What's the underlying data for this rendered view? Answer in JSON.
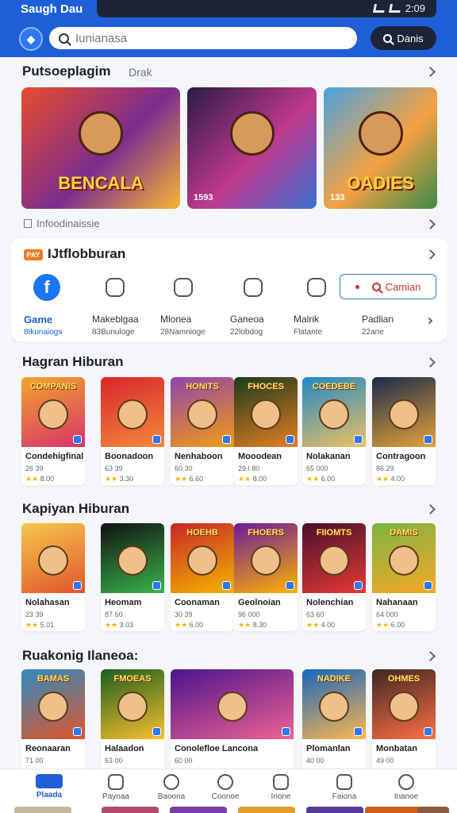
{
  "status": {
    "left": "Saugh Dau",
    "right": "2:09"
  },
  "search": {
    "placeholder": "Iunianasa",
    "button": "Danis"
  },
  "sections": {
    "featured": {
      "title": "Putsoeplagim",
      "subtitle": "Drak"
    },
    "note": "Infoodinaissie",
    "categories": {
      "badge": "PAY",
      "title": "IJtflobburan",
      "button": "Camian",
      "items": [
        {
          "label": "Game",
          "count": "8Ikunaiogs",
          "icon": "facebook-icon",
          "active": true
        },
        {
          "label": "Makeblgaa",
          "count": "83Bunuloge",
          "icon": "camera-icon"
        },
        {
          "label": "Mlonea",
          "count": "28Namnioge",
          "icon": "cross-icon"
        },
        {
          "label": "Ganeoa",
          "count": "22lobdog",
          "icon": "bag-icon"
        },
        {
          "label": "Malrik",
          "count": "Flatante",
          "icon": "receipt-icon"
        },
        {
          "label": "Padlian",
          "count": "22ane",
          "icon": "search-icon"
        }
      ]
    },
    "row1": {
      "title": "Hagran Hiburan"
    },
    "row2": {
      "title": "Kapiyan Hiburan"
    },
    "row3": {
      "title": "Ruakonig Ilaneoa:"
    }
  },
  "banners": [
    {
      "tag": "",
      "title": "BENCALA",
      "colors": [
        "#e94b2c",
        "#7b2d8e",
        "#f7b733"
      ]
    },
    {
      "tag": "1593",
      "title": "",
      "colors": [
        "#2a1a4a",
        "#c0398e",
        "#3a6fd1"
      ]
    },
    {
      "tag": "133",
      "title": "OADIES",
      "colors": [
        "#4aa3e0",
        "#f5a142",
        "#3a8a4a"
      ]
    }
  ],
  "games_row1": [
    {
      "name": "Condehigfinal",
      "size": "26 39",
      "rating": "8.00",
      "art": "COMPANIS",
      "colors": [
        "#f2a52b",
        "#d6336c"
      ]
    },
    {
      "name": "Boonadoon",
      "size": "63 39",
      "rating": "3.30",
      "art": "",
      "colors": [
        "#d7262b",
        "#f28a3a"
      ]
    },
    {
      "name": "Nenhaboon",
      "size": "60 30",
      "rating": "6.60",
      "art": "HONITS",
      "colors": [
        "#8e44ad",
        "#f39c12"
      ]
    },
    {
      "name": "Mooodean",
      "size": "29 I 80",
      "rating": "8.00",
      "art": "FHOCES",
      "colors": [
        "#1a3b1a",
        "#e67e22"
      ]
    },
    {
      "name": "Nolakanan",
      "size": "65 000",
      "rating": "6.00",
      "art": "COEDEBE",
      "colors": [
        "#1e88c7",
        "#f0c060"
      ]
    },
    {
      "name": "Contragoon",
      "size": "86 29",
      "rating": "4.00",
      "art": "",
      "colors": [
        "#1b2a4a",
        "#e6a33a"
      ]
    }
  ],
  "games_row2": [
    {
      "name": "Nolahasan",
      "size": "23 39",
      "rating": "5.01",
      "art": "",
      "colors": [
        "#f6c84c",
        "#e0552b"
      ]
    },
    {
      "name": "Heomam",
      "size": "87 60",
      "rating": "3.03",
      "art": "",
      "colors": [
        "#111111",
        "#39b54a"
      ]
    },
    {
      "name": "Coonaman",
      "size": "30 39",
      "rating": "6.00",
      "art": "HOEHB",
      "colors": [
        "#c62828",
        "#f4b400"
      ]
    },
    {
      "name": "Geolnoian",
      "size": "96 000",
      "rating": "8.30",
      "art": "FHOERS",
      "colors": [
        "#6a1b9a",
        "#ffb300"
      ]
    },
    {
      "name": "Nolenchian",
      "size": "63 60",
      "rating": "4.00",
      "art": "FIIOMTS",
      "colors": [
        "#4a0f2a",
        "#e53935"
      ]
    },
    {
      "name": "Nahanaan",
      "size": "64 000",
      "rating": "6.00",
      "art": "DAMIS",
      "colors": [
        "#7cb342",
        "#f9a825"
      ]
    }
  ],
  "games_row3": [
    {
      "name": "Reonaaran",
      "size": "71 00",
      "rating": "",
      "art": "BAMAS",
      "colors": [
        "#2e8bc0",
        "#e0552b"
      ]
    },
    {
      "name": "Halaadon",
      "size": "63 00",
      "rating": "",
      "art": "FMOEAS",
      "colors": [
        "#1b5e20",
        "#fbc02d"
      ]
    },
    {
      "name": "Conolefloe Lancona",
      "size": "60 00",
      "rating": "",
      "art": "",
      "colors": [
        "#4a148c",
        "#f06292"
      ]
    },
    {
      "name": "Plomanlan",
      "size": "40 00",
      "rating": "",
      "art": "NADIKE",
      "colors": [
        "#1565c0",
        "#ffb74d"
      ]
    },
    {
      "name": "Monbatan",
      "size": "49 00",
      "rating": "",
      "art": "OHMES",
      "colors": [
        "#3e2723",
        "#ff7043"
      ]
    }
  ],
  "nav": [
    {
      "label": "Plaada",
      "icon": "home-icon",
      "active": true
    },
    {
      "label": "Paynaa",
      "icon": "user-icon"
    },
    {
      "label": "Baoona",
      "icon": "people-icon"
    },
    {
      "label": "Coonoe",
      "icon": "compass-icon"
    },
    {
      "label": "Inone",
      "icon": "document-icon"
    },
    {
      "label": "Faiona",
      "icon": "gift-icon"
    },
    {
      "label": "Inanoe",
      "icon": "profile-icon"
    }
  ],
  "colors": {
    "primary": "#1e5fd8",
    "dark": "#1c2538",
    "accent": "#f07b22"
  }
}
